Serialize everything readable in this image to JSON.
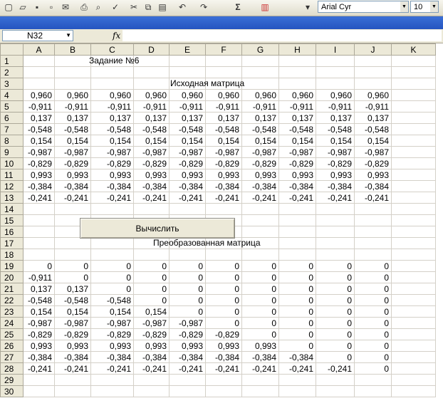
{
  "toolbar": {
    "font_name": "Arial Cyr",
    "font_size": "10",
    "sum_symbol": "Σ"
  },
  "formula_bar": {
    "name_box": "N32",
    "fx": "fx"
  },
  "columns": [
    "A",
    "B",
    "C",
    "D",
    "E",
    "F",
    "G",
    "H",
    "I",
    "J",
    "K"
  ],
  "rows": [
    {
      "n": "1",
      "label": "Задание №6",
      "label_col": "B",
      "label_offset": "center"
    },
    {
      "n": "2"
    },
    {
      "n": "3",
      "label": "Исходная матрица"
    },
    {
      "n": "4",
      "cells": [
        "0,960",
        "0,960",
        "0,960",
        "0,960",
        "0,960",
        "0,960",
        "0,960",
        "0,960",
        "0,960",
        "0,960"
      ]
    },
    {
      "n": "5",
      "cells": [
        "-0,911",
        "-0,911",
        "-0,911",
        "-0,911",
        "-0,911",
        "-0,911",
        "-0,911",
        "-0,911",
        "-0,911",
        "-0,911"
      ]
    },
    {
      "n": "6",
      "cells": [
        "0,137",
        "0,137",
        "0,137",
        "0,137",
        "0,137",
        "0,137",
        "0,137",
        "0,137",
        "0,137",
        "0,137"
      ]
    },
    {
      "n": "7",
      "cells": [
        "-0,548",
        "-0,548",
        "-0,548",
        "-0,548",
        "-0,548",
        "-0,548",
        "-0,548",
        "-0,548",
        "-0,548",
        "-0,548"
      ]
    },
    {
      "n": "8",
      "cells": [
        "0,154",
        "0,154",
        "0,154",
        "0,154",
        "0,154",
        "0,154",
        "0,154",
        "0,154",
        "0,154",
        "0,154"
      ]
    },
    {
      "n": "9",
      "cells": [
        "-0,987",
        "-0,987",
        "-0,987",
        "-0,987",
        "-0,987",
        "-0,987",
        "-0,987",
        "-0,987",
        "-0,987",
        "-0,987"
      ]
    },
    {
      "n": "10",
      "cells": [
        "-0,829",
        "-0,829",
        "-0,829",
        "-0,829",
        "-0,829",
        "-0,829",
        "-0,829",
        "-0,829",
        "-0,829",
        "-0,829"
      ]
    },
    {
      "n": "11",
      "cells": [
        "0,993",
        "0,993",
        "0,993",
        "0,993",
        "0,993",
        "0,993",
        "0,993",
        "0,993",
        "0,993",
        "0,993"
      ]
    },
    {
      "n": "12",
      "cells": [
        "-0,384",
        "-0,384",
        "-0,384",
        "-0,384",
        "-0,384",
        "-0,384",
        "-0,384",
        "-0,384",
        "-0,384",
        "-0,384"
      ]
    },
    {
      "n": "13",
      "cells": [
        "-0,241",
        "-0,241",
        "-0,241",
        "-0,241",
        "-0,241",
        "-0,241",
        "-0,241",
        "-0,241",
        "-0,241",
        "-0,241"
      ]
    },
    {
      "n": "14"
    },
    {
      "n": "15"
    },
    {
      "n": "16"
    },
    {
      "n": "17",
      "label": "Преобразованная матрица"
    },
    {
      "n": "18"
    },
    {
      "n": "19",
      "cells": [
        "0",
        "0",
        "0",
        "0",
        "0",
        "0",
        "0",
        "0",
        "0",
        "0"
      ]
    },
    {
      "n": "20",
      "cells": [
        "-0,911",
        "0",
        "0",
        "0",
        "0",
        "0",
        "0",
        "0",
        "0",
        "0"
      ]
    },
    {
      "n": "21",
      "cells": [
        "0,137",
        "0,137",
        "0",
        "0",
        "0",
        "0",
        "0",
        "0",
        "0",
        "0"
      ]
    },
    {
      "n": "22",
      "cells": [
        "-0,548",
        "-0,548",
        "-0,548",
        "0",
        "0",
        "0",
        "0",
        "0",
        "0",
        "0"
      ]
    },
    {
      "n": "23",
      "cells": [
        "0,154",
        "0,154",
        "0,154",
        "0,154",
        "0",
        "0",
        "0",
        "0",
        "0",
        "0"
      ]
    },
    {
      "n": "24",
      "cells": [
        "-0,987",
        "-0,987",
        "-0,987",
        "-0,987",
        "-0,987",
        "0",
        "0",
        "0",
        "0",
        "0"
      ]
    },
    {
      "n": "25",
      "cells": [
        "-0,829",
        "-0,829",
        "-0,829",
        "-0,829",
        "-0,829",
        "-0,829",
        "0",
        "0",
        "0",
        "0"
      ]
    },
    {
      "n": "26",
      "cells": [
        "0,993",
        "0,993",
        "0,993",
        "0,993",
        "0,993",
        "0,993",
        "0,993",
        "0",
        "0",
        "0"
      ]
    },
    {
      "n": "27",
      "cells": [
        "-0,384",
        "-0,384",
        "-0,384",
        "-0,384",
        "-0,384",
        "-0,384",
        "-0,384",
        "-0,384",
        "0",
        "0"
      ]
    },
    {
      "n": "28",
      "cells": [
        "-0,241",
        "-0,241",
        "-0,241",
        "-0,241",
        "-0,241",
        "-0,241",
        "-0,241",
        "-0,241",
        "-0,241",
        "0"
      ]
    },
    {
      "n": "29"
    },
    {
      "n": "30"
    }
  ],
  "button": {
    "label": "Вычислить"
  }
}
